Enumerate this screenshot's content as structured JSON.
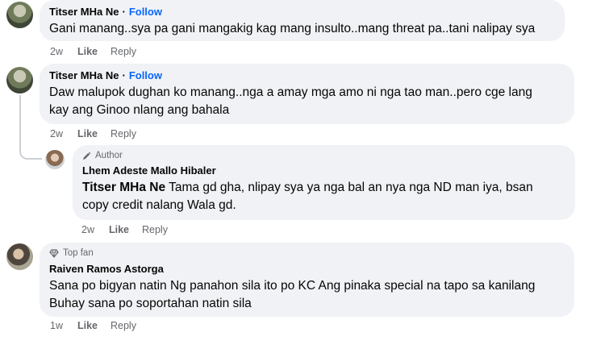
{
  "comments": [
    {
      "author": "Titser MHa Ne",
      "separator": "·",
      "follow": "Follow",
      "text": "Gani manang..sya pa gani mangakig kag mang insulto..mang threat pa..tani nalipay sya",
      "time": "2w",
      "like": "Like",
      "reply": "Reply"
    },
    {
      "author": "Titser MHa Ne",
      "separator": "·",
      "follow": "Follow",
      "text_line1": "Daw malupok dughan ko manang..nga a amay mga amo ni nga tao man..pero cge lang",
      "text_line2": "kay ang Ginoo nlang ang bahala",
      "time": "2w",
      "like": "Like",
      "reply": "Reply"
    },
    {
      "badge": "Author",
      "author": "Lhem Adeste Mallo Hibaler",
      "mention": "Titser MHa Ne",
      "text_line1": " Tama gd gha, nlipay sya ya nga bal an nya nga ND man iya, bsan",
      "text_line2": "copy credit nalang Wala gd.",
      "time": "2w",
      "like": "Like",
      "reply": "Reply"
    },
    {
      "badge": "Top fan",
      "author": "Raiven Ramos Astorga",
      "text_line1": "Sana po bigyan natin Ng panahon sila ito po KC Ang pinaka special na tapo sa kanilang",
      "text_line2": "Buhay sana po soportahan natin sila",
      "time": "1w",
      "like": "Like",
      "reply": "Reply"
    }
  ],
  "colors": {
    "bubble": "#f0f2f5",
    "follow": "#0866ff",
    "meta": "#65676b"
  },
  "icons": {
    "author_badge": "pen-icon",
    "fan_badge": "diamond-icon"
  }
}
